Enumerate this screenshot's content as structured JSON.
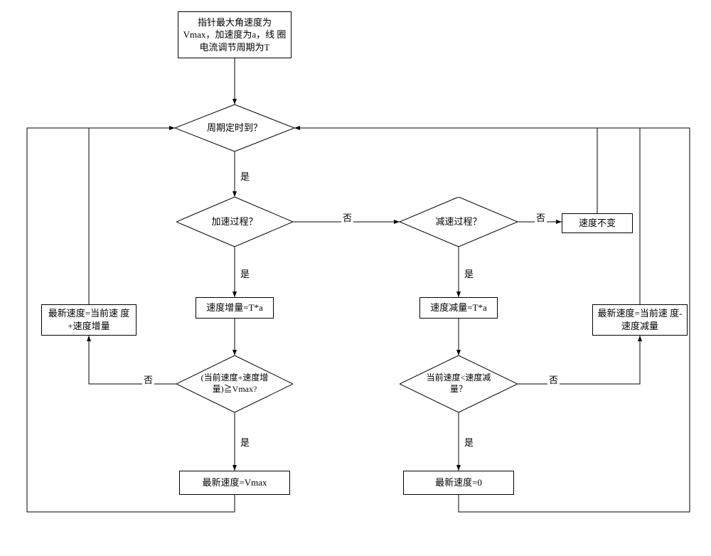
{
  "nodes": {
    "start": "指针最大角速度为\nVmax，加速度为a，线\n圈电流调节周期为T",
    "timerExpired": "周期定时到？",
    "accelProcess": "加速过程？",
    "decelProcess": "减速过程？",
    "speedUnchanged": "速度不变",
    "incFormula": "速度增量=T*a",
    "decFormula": "速度减量=T*a",
    "incCheck": "(当前速度+速度增\n量)≧Vmax?",
    "decCheck": "当前速度<速度减\n量？",
    "newAddInc": "最新速度=当前速\n度+速度增量",
    "newSubDec": "最新速度=当前速\n度-速度减量",
    "newVmax": "最新速度=Vmax",
    "newZero": "最新速度=0"
  },
  "edges": {
    "yes": "是",
    "no": "否"
  }
}
